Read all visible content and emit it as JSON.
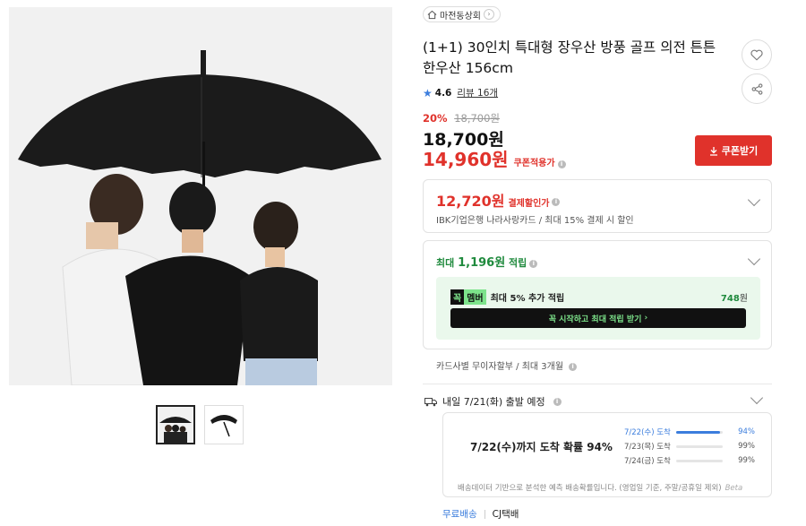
{
  "store": {
    "name": "마전동상회"
  },
  "product": {
    "title": "(1+1) 30인치 특대형 장우산 방풍 골프 의전 튼튼한우산 156cm",
    "rating": "4.6",
    "review_label": "리뷰 16개"
  },
  "price": {
    "discount": "20%",
    "original": "18,700원",
    "sale": "18,700원",
    "coupon_price": "14,960원",
    "coupon_note": "쿠폰적용가",
    "coupon_button": "쿠폰받기"
  },
  "card_discount": {
    "amount": "12,720원",
    "label": "결제할인가",
    "detail": "IBK기업은행 나라사랑카드 / 최대 15% 결제 시 할인"
  },
  "points": {
    "prefix": "최대",
    "amount": "1,196원",
    "suffix": "적립",
    "member_tag_a": "꼭",
    "member_tag_b": "멤버",
    "member_text": "최대 5% 추가 적립",
    "member_amount": "748",
    "member_unit": "원",
    "start_button": "꼭 시작하고 최대 적립 받기"
  },
  "installment": "카드사별 무이자할부 / 최대 3개월",
  "shipping": {
    "head": "내일 7/21(화) 출발 예정",
    "big": "7/22(수)까지 도착 확률 94%",
    "rows": [
      {
        "date": "7/22(수) 도착",
        "pct": "94%",
        "value": 0.94
      },
      {
        "date": "7/23(목) 도착",
        "pct": "99%",
        "value": 0.99
      },
      {
        "date": "7/24(금) 도착",
        "pct": "99%",
        "value": 0.99
      }
    ],
    "note": "배송데이터 기반으로 분석한 예측 배송확률입니다. (영업일 기준, 주말/공휴일 제외)",
    "brand": "Beta"
  },
  "footer": {
    "free": "무료배송",
    "carrier": "CJ택배"
  }
}
